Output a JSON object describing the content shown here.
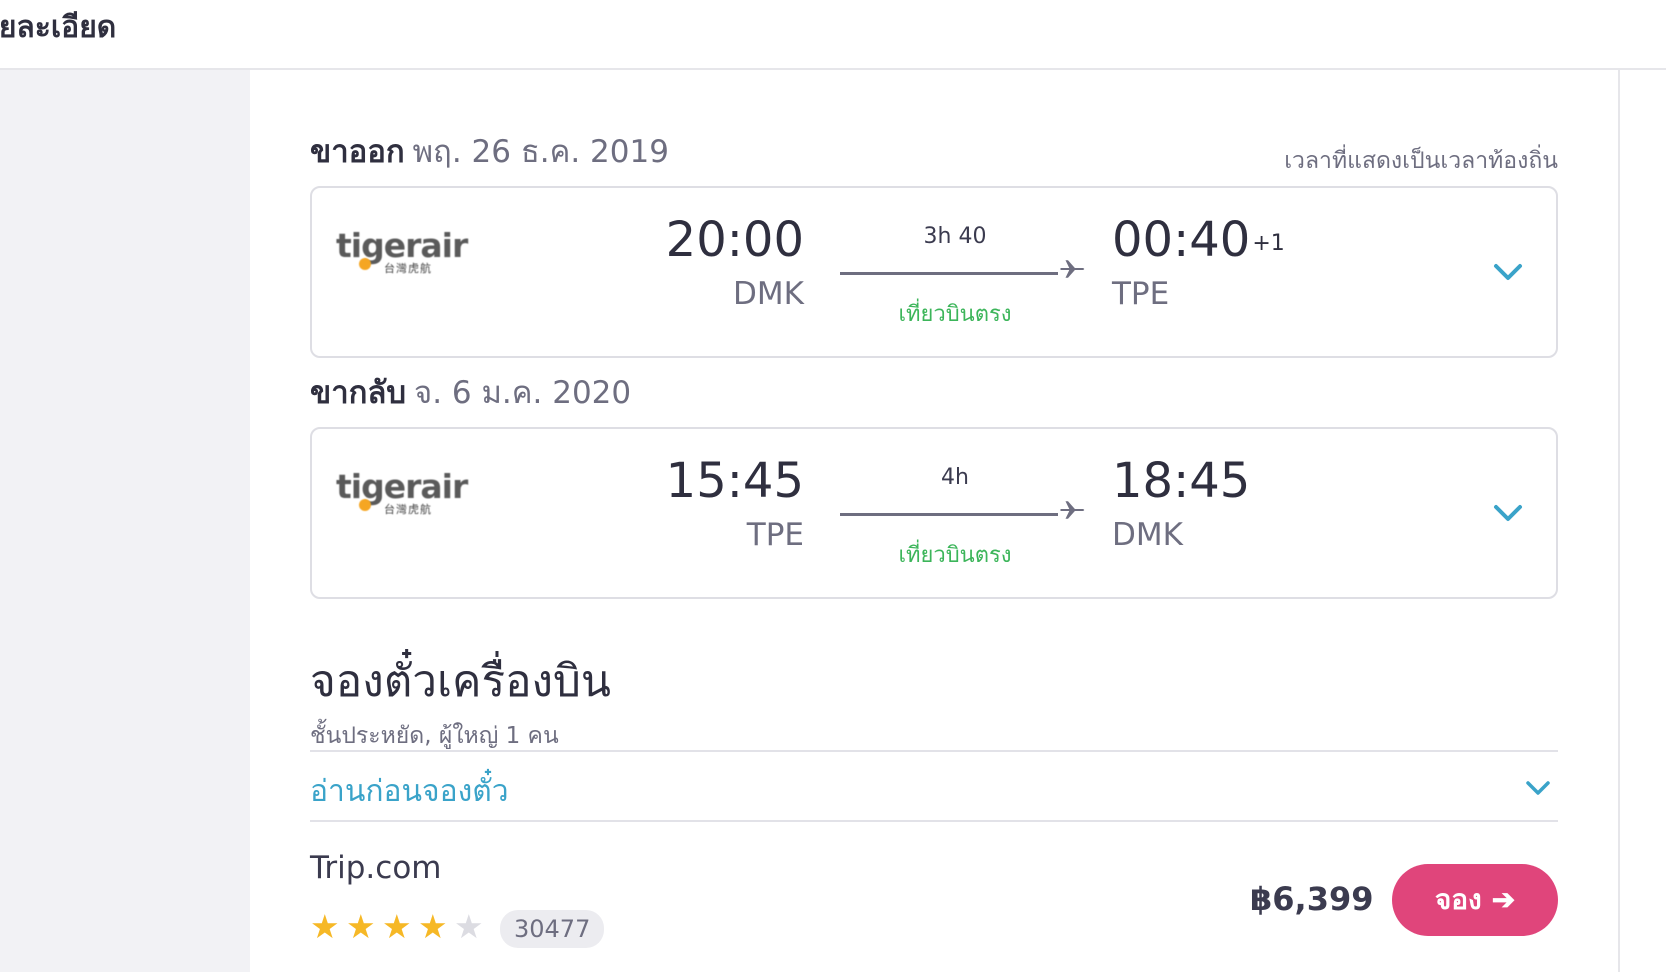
{
  "header": {
    "title": "ายละเอียด"
  },
  "legs": [
    {
      "kind": "ขาออก",
      "date": "พฤ. 26 ธ.ค. 2019",
      "airline_logo": "tigerair",
      "airline_logo_sub": "台灣虎航",
      "dep_time": "20:00",
      "dep_code": "DMK",
      "duration": "3h 40",
      "stops": "เที่ยวบินตรง",
      "arr_time": "00:40",
      "arr_day_offset": "+1",
      "arr_code": "TPE"
    },
    {
      "kind": "ขากลับ",
      "date": "จ. 6 ม.ค. 2020",
      "airline_logo": "tigerair",
      "airline_logo_sub": "台灣虎航",
      "dep_time": "15:45",
      "dep_code": "TPE",
      "duration": "4h",
      "stops": "เที่ยวบินตรง",
      "arr_time": "18:45",
      "arr_day_offset": "",
      "arr_code": "DMK"
    }
  ],
  "local_time_note": "เวลาที่แสดงเป็นเวลาท้องถิ่น",
  "booking": {
    "title": "จองตั๋วเครื่องบิน",
    "subtitle": "ชั้นประหยัด, ผู้ใหญ่ 1 คน",
    "read_before": "อ่านก่อนจองตั๋ว"
  },
  "offer": {
    "provider": "Trip.com",
    "rating": 4,
    "rating_max": 5,
    "review_count": "30477",
    "price": "฿6,399",
    "book_label": "จอง"
  },
  "colors": {
    "accent_blue": "#3aa3c9",
    "direct_green": "#3cb55a",
    "book_pink": "#e0457b",
    "star_gold": "#f6b826"
  }
}
